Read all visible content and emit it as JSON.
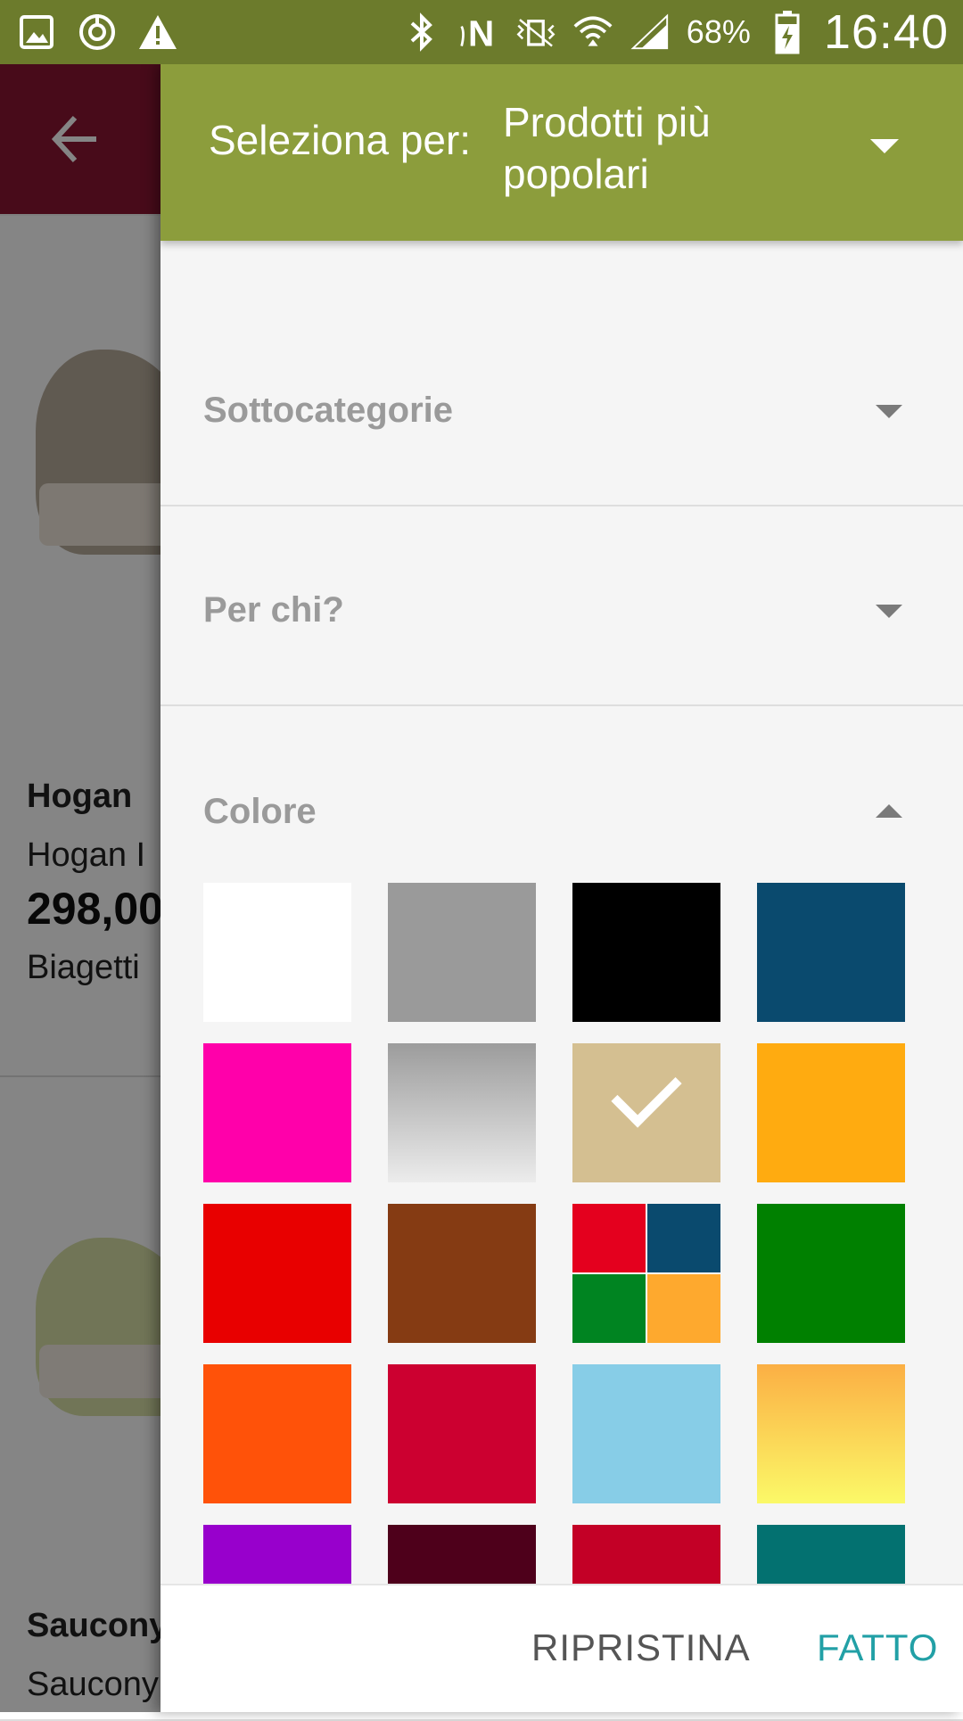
{
  "status_bar": {
    "left_icons": [
      "image-icon",
      "sync-icon",
      "warning-icon"
    ],
    "right_icons": [
      "bluetooth-icon",
      "nfc-icon",
      "vibrate-icon",
      "wifi-icon",
      "signal-icon"
    ],
    "battery_percent": "68%",
    "time": "16:40"
  },
  "background_app": {
    "appbar_color": "#8a1632",
    "products": [
      {
        "brand": "Hogan",
        "name": "Hogan I",
        "price": "298,00",
        "shop": "Biagetti"
      },
      {
        "brand": "Saucony",
        "name": "Saucony",
        "price": "",
        "shop": ""
      }
    ]
  },
  "drawer": {
    "sort": {
      "label": "Seleziona per:",
      "value": "Prodotti più popolari"
    },
    "sections": [
      {
        "title": "Sottocategorie",
        "expanded": false
      },
      {
        "title": "Per chi?",
        "expanded": false
      },
      {
        "title": "Colore",
        "expanded": true
      }
    ],
    "colors": [
      {
        "name": "white",
        "color": "#ffffff",
        "selected": false
      },
      {
        "name": "grey",
        "color": "#9a9a9a",
        "selected": false
      },
      {
        "name": "black",
        "color": "#000000",
        "selected": false
      },
      {
        "name": "navy",
        "color": "#0a4a6e",
        "selected": false
      },
      {
        "name": "pink",
        "color": "#ff00aa",
        "selected": false
      },
      {
        "name": "silver",
        "color": "gradient",
        "gradient": [
          "#9c9c9c",
          "#ececec"
        ],
        "selected": false
      },
      {
        "name": "beige",
        "color": "#d4bf91",
        "selected": true
      },
      {
        "name": "yellow-orange",
        "color": "#ffab10",
        "selected": false
      },
      {
        "name": "red",
        "color": "#e80000",
        "selected": false
      },
      {
        "name": "brown",
        "color": "#853b13",
        "selected": false
      },
      {
        "name": "multicolor",
        "color": "multi",
        "quadrants": [
          "#e4001e",
          "#0a4a6e",
          "#008421",
          "#fea92e"
        ],
        "selected": false
      },
      {
        "name": "green",
        "color": "#008000",
        "selected": false
      },
      {
        "name": "orange",
        "color": "#ff5209",
        "selected": false
      },
      {
        "name": "crimson",
        "color": "#cc0030",
        "selected": false
      },
      {
        "name": "light-blue",
        "color": "#87cde7",
        "selected": false
      },
      {
        "name": "gold",
        "color": "gradient",
        "gradient": [
          "#fbaf44",
          "#fbf968"
        ],
        "selected": false
      },
      {
        "name": "purple",
        "color": "#9800cc",
        "selected": false
      },
      {
        "name": "dark-burgundy",
        "color": "#4e001b",
        "selected": false
      },
      {
        "name": "dark-red",
        "color": "#c30026",
        "selected": false
      },
      {
        "name": "teal",
        "color": "#037170",
        "selected": false
      }
    ],
    "footer": {
      "reset_label": "RIPRISTINA",
      "done_label": "FATTO"
    }
  }
}
